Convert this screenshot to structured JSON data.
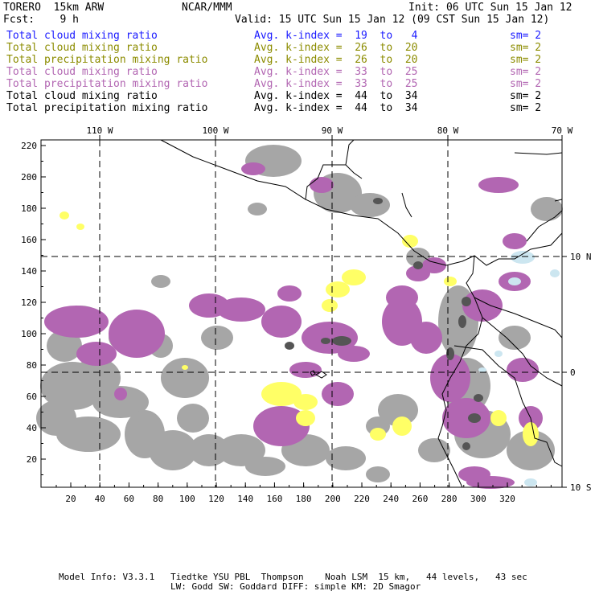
{
  "header": {
    "model": "TORERO  15km ARW",
    "org": "NCAR/MMM",
    "init": "Init: 06 UTC Sun 15 Jan 12",
    "fcst": "Fcst:    9 h",
    "valid": "Valid: 15 UTC Sun 15 Jan 12 (09 CST Sun 15 Jan 12)"
  },
  "legend": [
    {
      "field": "Total cloud mixing ratio",
      "kindex": "Avg. k-index =  19  to   4",
      "sm": "sm= 2",
      "color": "#1a1aff"
    },
    {
      "field": "Total cloud mixing ratio",
      "kindex": "Avg. k-index =  26  to  20",
      "sm": "sm= 2",
      "color": "#8c8c00"
    },
    {
      "field": "Total precipitation mixing ratio",
      "kindex": "Avg. k-index =  26  to  20",
      "sm": "sm= 2",
      "color": "#8c8c00"
    },
    {
      "field": "Total cloud mixing ratio",
      "kindex": "Avg. k-index =  33  to  25",
      "sm": "sm= 2",
      "color": "#b266b2"
    },
    {
      "field": "Total precipitation mixing ratio",
      "kindex": "Avg. k-index =  33  to  25",
      "sm": "sm= 2",
      "color": "#b266b2"
    },
    {
      "field": "Total cloud mixing ratio",
      "kindex": "Avg. k-index =  44  to  34",
      "sm": "sm= 2",
      "color": "#000000"
    },
    {
      "field": "Total precipitation mixing ratio",
      "kindex": "Avg. k-index =  44  to  34",
      "sm": "sm= 2",
      "color": "#000000"
    }
  ],
  "map": {
    "top_lon_labels": [
      "110 W",
      "100 W",
      "90 W",
      "80 W",
      "70 W"
    ],
    "right_lat_labels": [
      "10 N",
      "0",
      "10 S"
    ],
    "left_y_ticks": [
      "220",
      "200",
      "180",
      "160",
      "140",
      "120",
      "100",
      "80",
      "60",
      "40",
      "20"
    ],
    "bottom_x_ticks": [
      "20",
      "40",
      "60",
      "80",
      "100",
      "120",
      "140",
      "160",
      "180",
      "200",
      "220",
      "240",
      "260",
      "280",
      "300",
      "320"
    ],
    "colors": {
      "gray": "#a6a6a6",
      "dark_gray": "#555555",
      "purple": "#b266b2",
      "yellow": "#ffff66",
      "light_blue": "#cce6f0"
    }
  },
  "footer": {
    "line1": "Model Info: V3.3.1   Tiedtke YSU PBL  Thompson    Noah LSM  15 km,   44 levels,   43 sec",
    "line2": "LW: Godd SW: Goddard DIFF: simple KM: 2D Smagor"
  }
}
